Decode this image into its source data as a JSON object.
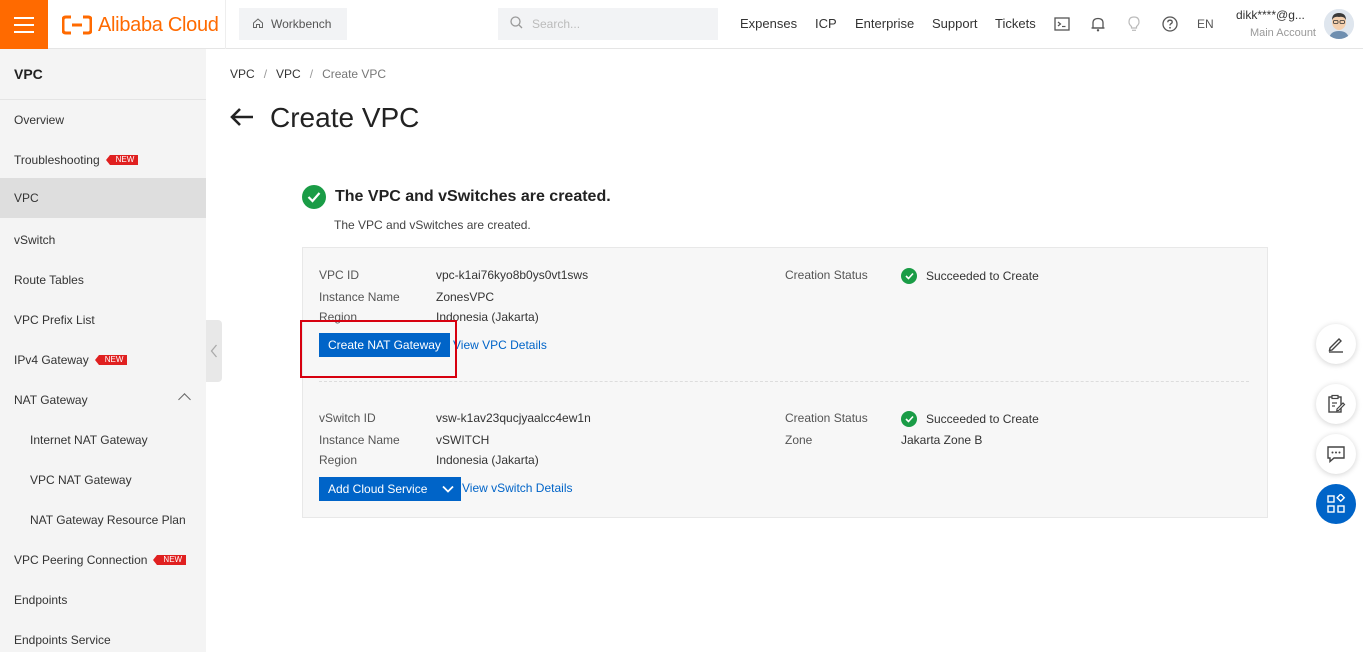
{
  "topbar": {
    "logo_text": "Alibaba Cloud",
    "workbench_label": "Workbench",
    "search_placeholder": "Search...",
    "nav": [
      "Expenses",
      "ICP",
      "Enterprise",
      "Support",
      "Tickets"
    ],
    "language": "EN",
    "account_email": "dikk****@g...",
    "account_role": "Main Account"
  },
  "sidebar": {
    "title": "VPC",
    "badge_text": "NEW",
    "items": [
      {
        "label": "Overview"
      },
      {
        "label": "Troubleshooting",
        "badge": true
      },
      {
        "label": "VPC",
        "active": true
      },
      {
        "label": "vSwitch"
      },
      {
        "label": "Route Tables"
      },
      {
        "label": "VPC Prefix List"
      },
      {
        "label": "IPv4 Gateway",
        "badge": true
      },
      {
        "label": "NAT Gateway",
        "expanded": true
      },
      {
        "label": "Internet NAT Gateway",
        "sub": true
      },
      {
        "label": "VPC NAT Gateway",
        "sub": true
      },
      {
        "label": "NAT Gateway Resource Plan",
        "sub": true
      },
      {
        "label": "VPC Peering Connection",
        "badge": true
      },
      {
        "label": "Endpoints"
      },
      {
        "label": "Endpoints Service"
      }
    ]
  },
  "breadcrumb": [
    "VPC",
    "VPC",
    "Create VPC"
  ],
  "page_title": "Create VPC",
  "result": {
    "title": "The VPC and vSwitches are created.",
    "subtitle": "The VPC and vSwitches are created."
  },
  "vpc": {
    "id_label": "VPC ID",
    "id": "vpc-k1ai76kyo8b0ys0vt1sws",
    "name_label": "Instance Name",
    "name": "ZonesVPC",
    "region_label": "Region",
    "region": "Indonesia (Jakarta)",
    "status_label": "Creation Status",
    "status": "Succeeded to Create",
    "primary_button": "Create NAT Gateway",
    "details_link": "View VPC Details"
  },
  "vswitch": {
    "id_label": "vSwitch ID",
    "id": "vsw-k1av23qucjyaalcc4ew1n",
    "name_label": "Instance Name",
    "name": "vSWITCH",
    "region_label": "Region",
    "region": "Indonesia (Jakarta)",
    "status_label": "Creation Status",
    "status": "Succeeded to Create",
    "zone_label": "Zone",
    "zone": "Jakarta Zone B",
    "primary_button": "Add Cloud Service",
    "details_link": "View vSwitch Details"
  },
  "colors": {
    "brand": "#ff6a00",
    "primary": "#0064c8",
    "success": "#1a9c46",
    "highlight": "#d7000f"
  }
}
